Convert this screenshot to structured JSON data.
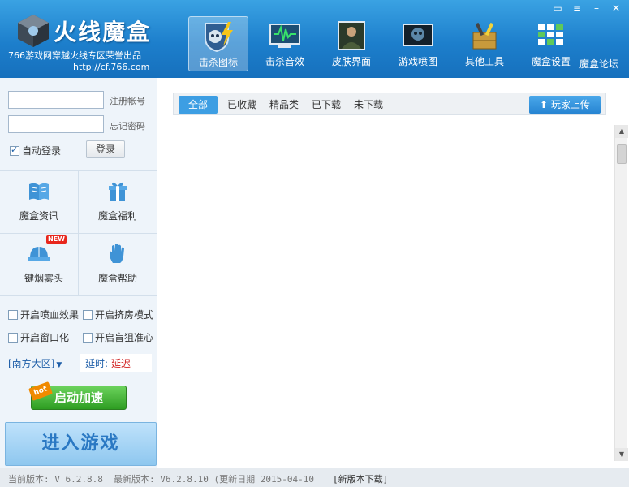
{
  "header": {
    "title": "火线魔盒",
    "subtitle": "766游戏网穿越火线专区荣誉出品",
    "url": "http://cf.766.com",
    "nav": [
      {
        "label": "击杀图标",
        "icon": "skull-lightning-icon",
        "active": true
      },
      {
        "label": "击杀音效",
        "icon": "sound-wave-monitor-icon"
      },
      {
        "label": "皮肤界面",
        "icon": "soldier-portrait-icon"
      },
      {
        "label": "游戏喷图",
        "icon": "spray-skull-icon"
      },
      {
        "label": "其他工具",
        "icon": "tools-crate-icon"
      },
      {
        "label": "魔盒设置",
        "icon": "settings-grid-icon"
      }
    ],
    "forum": "魔盒论坛"
  },
  "login": {
    "account_placeholder": "",
    "password_placeholder": "",
    "register_link": "注册帐号",
    "forgot_link": "忘记密码",
    "auto_login": "自动登录",
    "login_button": "登录"
  },
  "features": [
    {
      "label": "魔盒资讯",
      "icon": "book-icon"
    },
    {
      "label": "魔盒福利",
      "icon": "gift-icon"
    },
    {
      "label": "一键烟雾头",
      "icon": "helmet-icon",
      "badge": "NEW"
    },
    {
      "label": "魔盒帮助",
      "icon": "hand-icon"
    }
  ],
  "options": [
    {
      "label": "开启喷血效果",
      "checked": false
    },
    {
      "label": "开启挤房模式",
      "checked": false
    },
    {
      "label": "开启窗口化",
      "checked": false
    },
    {
      "label": "开启盲狙准心",
      "checked": false
    }
  ],
  "region": "[南方大区]",
  "latency": {
    "label": "延时:",
    "value": "延迟"
  },
  "accelerate": {
    "label": "启动加速",
    "tag": "hot"
  },
  "enter_game": "进入游戏",
  "filter": {
    "tabs": [
      "全部",
      "已收藏",
      "精品类",
      "已下载",
      "未下载"
    ],
    "upload": "玩家上传"
  },
  "status": {
    "current": "当前版本: V 6.2.8.8",
    "latest": "最新版本: V6.2.8.10 (更新日期 2015-04-10",
    "download": "[新版本下载]"
  },
  "colors": {
    "header": "#1d7fcc",
    "accent": "#3d9ee3",
    "accelerate": "#2e9d22",
    "latency": "#d02020"
  }
}
